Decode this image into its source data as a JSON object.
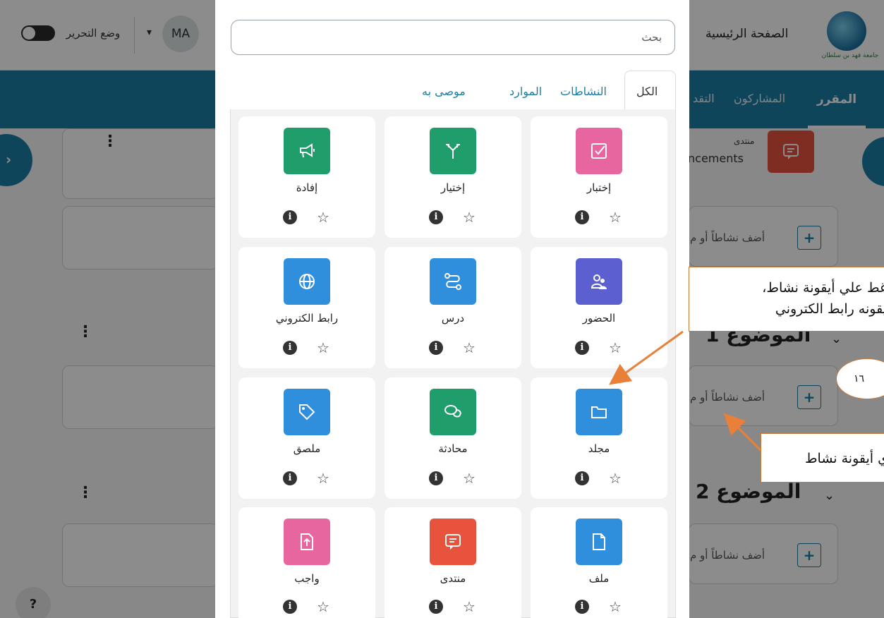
{
  "header": {
    "edit_mode_label": "وضع التحرير",
    "avatar_initials": "MA",
    "home_link": "الصفحة الرئيسية",
    "logo_text": "جامعة فهد بن سلطان"
  },
  "nav": {
    "course": "المقرر",
    "participants": "المشاركون",
    "grades": "التقد"
  },
  "help": {
    "label": "?"
  },
  "background_course": {
    "forum_type": "منتدى",
    "forum_name": "ncements",
    "add_activity_label": "أضف نشاطاً أو م",
    "section_1_title": "الموضوع 1",
    "section_2_title": "الموضوع 2"
  },
  "chooser": {
    "search_placeholder": "بحث",
    "tabs": [
      {
        "label": "الكل",
        "active": true
      },
      {
        "label": "النشاطات",
        "active": false
      },
      {
        "label": "الموارد",
        "active": false
      },
      {
        "label": "موصى به",
        "active": false
      }
    ],
    "tiles": [
      {
        "label": "إختبار",
        "icon": "checkbox-icon",
        "color": "#e8669f"
      },
      {
        "label": "إختيار",
        "icon": "choice-icon",
        "color": "#1f9e6b"
      },
      {
        "label": "إفادة",
        "icon": "megaphone-icon",
        "color": "#1f9e6b"
      },
      {
        "label": "الحضور",
        "icon": "attendance-icon",
        "color": "#5b5fcf"
      },
      {
        "label": "درس",
        "icon": "lesson-icon",
        "color": "#2f8fdc"
      },
      {
        "label": "رابط الكتروني",
        "icon": "globe-icon",
        "color": "#2f8fdc"
      },
      {
        "label": "مجلد",
        "icon": "folder-icon",
        "color": "#2f8fdc"
      },
      {
        "label": "محادثة",
        "icon": "chat-icon",
        "color": "#1f9e6b"
      },
      {
        "label": "ملصق",
        "icon": "tag-icon",
        "color": "#2f8fdc"
      },
      {
        "label": "ملف",
        "icon": "file-icon",
        "color": "#2f8fdc"
      },
      {
        "label": "منتدى",
        "icon": "forum-icon",
        "color": "#e8533e"
      },
      {
        "label": "واجب",
        "icon": "assignment-icon",
        "color": "#e8669f"
      }
    ]
  },
  "annotations": {
    "callout_1_line_1": "غط علي أيقونة نشاط،",
    "callout_1_line_2": "يقونه رابط الكتروني",
    "callout_2": "ي أيقونة نشاط",
    "page_number": "١٦"
  },
  "colors": {
    "brand": "#1c7fa6",
    "annotation_orange": "#e8803a"
  }
}
